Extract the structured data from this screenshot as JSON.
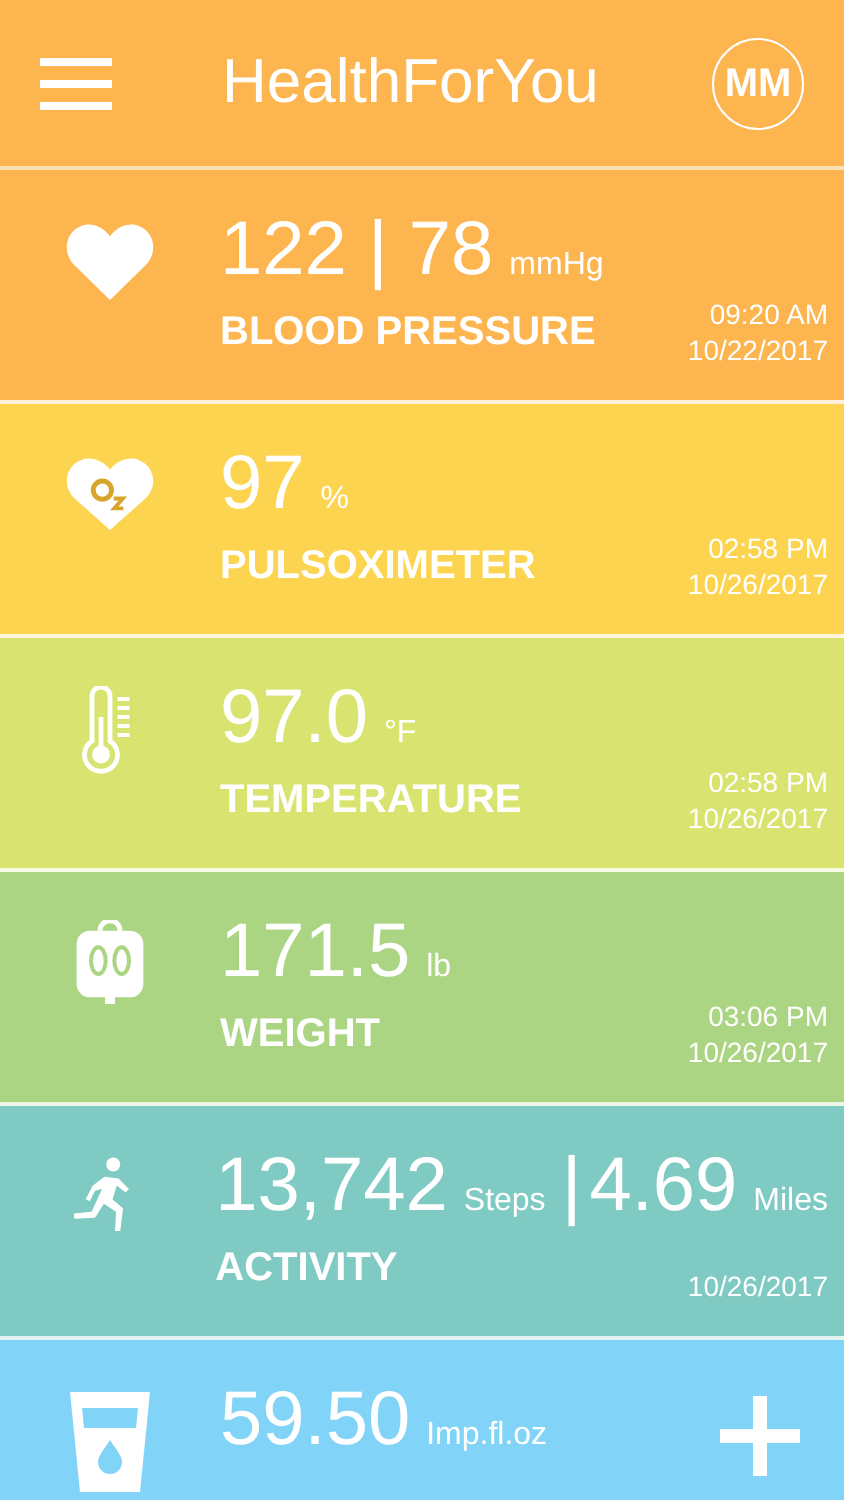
{
  "header": {
    "title": "HealthForYou",
    "avatar": "MM"
  },
  "tiles": [
    {
      "kind": "heart",
      "color": "#fdb54f",
      "value": [
        {
          "text": "122 | 78",
          "kind": "big"
        },
        {
          "text": "mmHg",
          "kind": "unit"
        }
      ],
      "label": "BLOOD PRESSURE",
      "time": "09:20 AM",
      "date": "10/22/2017"
    },
    {
      "kind": "oxygen",
      "color": "#fdd44f",
      "value": [
        {
          "text": "97",
          "kind": "big"
        },
        {
          "text": "%",
          "kind": "unit"
        }
      ],
      "label": "PULSOXIMETER",
      "time": "02:58 PM",
      "date": "10/26/2017"
    },
    {
      "kind": "thermometer",
      "color": "#d9e470",
      "value": [
        {
          "text": "97.0",
          "kind": "big"
        },
        {
          "text": "°F",
          "kind": "unit"
        }
      ],
      "label": "TEMPERATURE",
      "time": "02:58 PM",
      "date": "10/26/2017"
    },
    {
      "kind": "scale",
      "color": "#acd583",
      "value": [
        {
          "text": "171.5",
          "kind": "big"
        },
        {
          "text": "lb",
          "kind": "unit"
        }
      ],
      "label": "WEIGHT",
      "time": "03:06 PM",
      "date": "10/26/2017"
    },
    {
      "kind": "runner",
      "color": "#7fcac3",
      "value": [
        {
          "text": "13,742",
          "kind": "big"
        },
        {
          "text": "Steps",
          "kind": "unit"
        },
        {
          "text": "|",
          "kind": "big"
        },
        {
          "text": "4.69",
          "kind": "big"
        },
        {
          "text": "Miles",
          "kind": "unit"
        }
      ],
      "label": "ACTIVITY",
      "date": "10/26/2017"
    },
    {
      "kind": "water",
      "color": "#81d3f8",
      "value": [
        {
          "text": "59.50",
          "kind": "big"
        },
        {
          "text": "Imp.fl.oz",
          "kind": "unit"
        }
      ],
      "add": true
    }
  ]
}
